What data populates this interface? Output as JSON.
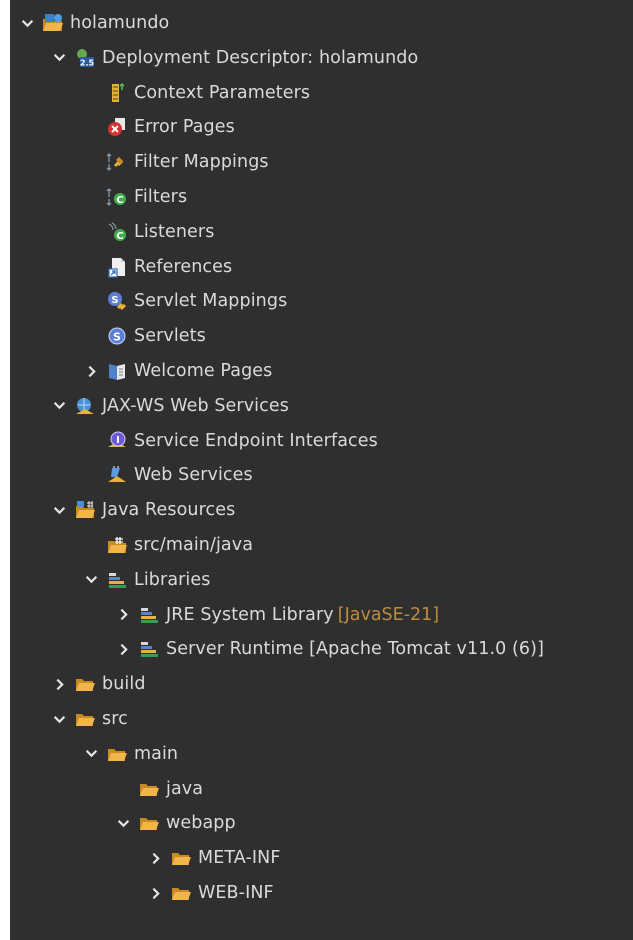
{
  "tree": {
    "items": [
      {
        "label": "holamundo",
        "level": 0,
        "toggle": "expanded",
        "icon": "web-project-icon"
      },
      {
        "label": "Deployment Descriptor: holamundo",
        "level": 1,
        "toggle": "expanded",
        "icon": "deployment-descriptor-icon"
      },
      {
        "label": "Context Parameters",
        "level": 2,
        "toggle": "none",
        "icon": "context-parameters-icon"
      },
      {
        "label": "Error Pages",
        "level": 2,
        "toggle": "none",
        "icon": "error-pages-icon"
      },
      {
        "label": "Filter Mappings",
        "level": 2,
        "toggle": "none",
        "icon": "filter-mappings-icon"
      },
      {
        "label": "Filters",
        "level": 2,
        "toggle": "none",
        "icon": "filters-icon"
      },
      {
        "label": "Listeners",
        "level": 2,
        "toggle": "none",
        "icon": "listeners-icon"
      },
      {
        "label": "References",
        "level": 2,
        "toggle": "none",
        "icon": "references-icon"
      },
      {
        "label": "Servlet Mappings",
        "level": 2,
        "toggle": "none",
        "icon": "servlet-mappings-icon"
      },
      {
        "label": "Servlets",
        "level": 2,
        "toggle": "none",
        "icon": "servlets-icon"
      },
      {
        "label": "Welcome Pages",
        "level": 2,
        "toggle": "collapsed",
        "icon": "welcome-pages-icon"
      },
      {
        "label": "JAX-WS Web Services",
        "level": 1,
        "toggle": "expanded",
        "icon": "jaxws-icon"
      },
      {
        "label": "Service Endpoint Interfaces",
        "level": 2,
        "toggle": "none",
        "icon": "service-endpoint-icon"
      },
      {
        "label": "Web Services",
        "level": 2,
        "toggle": "none",
        "icon": "web-services-icon"
      },
      {
        "label": "Java Resources",
        "level": 1,
        "toggle": "expanded",
        "icon": "java-resources-icon"
      },
      {
        "label": "src/main/java",
        "level": 2,
        "toggle": "none",
        "icon": "source-folder-icon"
      },
      {
        "label": "Libraries",
        "level": 2,
        "toggle": "expanded",
        "icon": "libraries-icon"
      },
      {
        "label": "JRE System Library",
        "level": 3,
        "toggle": "collapsed",
        "icon": "library-icon",
        "decoration": "[JavaSE-21]"
      },
      {
        "label": "Server Runtime [Apache Tomcat v11.0 (6)]",
        "level": 3,
        "toggle": "collapsed",
        "icon": "library-icon"
      },
      {
        "label": "build",
        "level": 1,
        "toggle": "collapsed",
        "icon": "folder-icon"
      },
      {
        "label": "src",
        "level": 1,
        "toggle": "expanded",
        "icon": "folder-icon"
      },
      {
        "label": "main",
        "level": 2,
        "toggle": "expanded",
        "icon": "folder-icon"
      },
      {
        "label": "java",
        "level": 3,
        "toggle": "none",
        "icon": "folder-icon"
      },
      {
        "label": "webapp",
        "level": 3,
        "toggle": "expanded",
        "icon": "folder-icon"
      },
      {
        "label": "META-INF",
        "level": 4,
        "toggle": "collapsed",
        "icon": "folder-icon"
      },
      {
        "label": "WEB-INF",
        "level": 4,
        "toggle": "collapsed",
        "icon": "folder-icon"
      }
    ]
  },
  "colors": {
    "background": "#2f2f2f",
    "text": "#dadada",
    "decoration": "#c08a3e",
    "folder": "#e8a23a"
  }
}
